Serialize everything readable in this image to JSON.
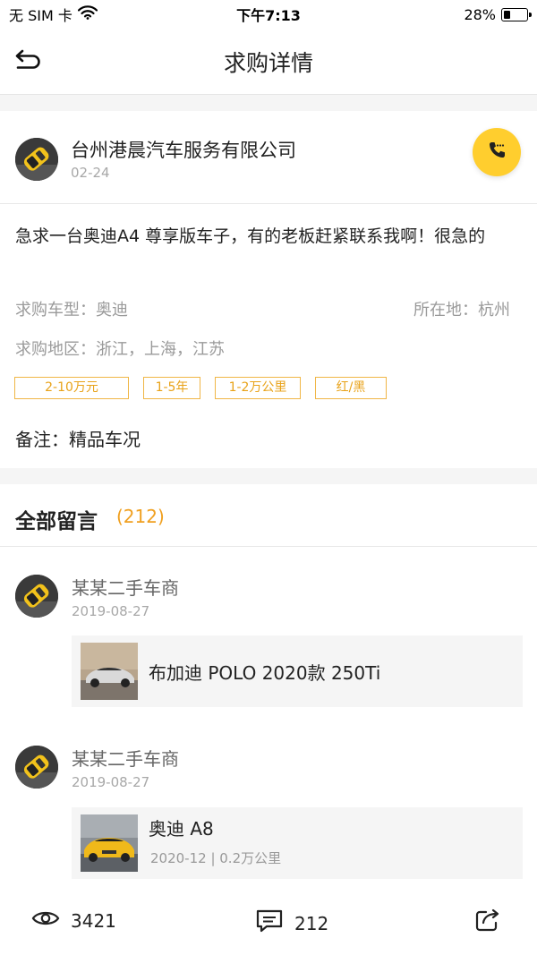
{
  "status_bar": {
    "carrier": "无 SIM 卡",
    "time": "下午7:13",
    "battery": "28%",
    "battery_level": 0.28
  },
  "nav": {
    "title": "求购详情",
    "back_icon": "back-arrow-icon"
  },
  "post": {
    "company": "台州港晨汽车服务有限公司",
    "date": "02-24",
    "content": "急求一台奥迪A4 尊享版车子，有的老板赶紧联系我啊！很急的",
    "car_model": "求购车型：奥迪",
    "location": "所在地：杭州",
    "region": "求购地区：浙江，上海，江苏",
    "tags": [
      "2-10万元",
      "1-5年",
      "1-2万公里",
      "红/黑"
    ],
    "remark": "备注：精品车况",
    "call_icon": "phone-icon"
  },
  "comments": {
    "title": "全部留言",
    "count": "(212)",
    "items": [
      {
        "name": "某某二手车商",
        "date": "2019-08-27",
        "car_title": "布加迪 POLO 2020款 250Ti",
        "car_sub": ""
      },
      {
        "name": "某某二手车商",
        "date": "2019-08-27",
        "car_title": "奥迪 A8",
        "car_sub": "2020-12 | 0.2万公里"
      }
    ]
  },
  "footer": {
    "views": "3421",
    "comments": "212",
    "view_icon": "eye-icon",
    "comment_icon": "comment-icon",
    "share_icon": "share-icon"
  },
  "colors": {
    "accent": "#ffce2e",
    "tag": "#e8a218",
    "count": "#f0a020"
  }
}
